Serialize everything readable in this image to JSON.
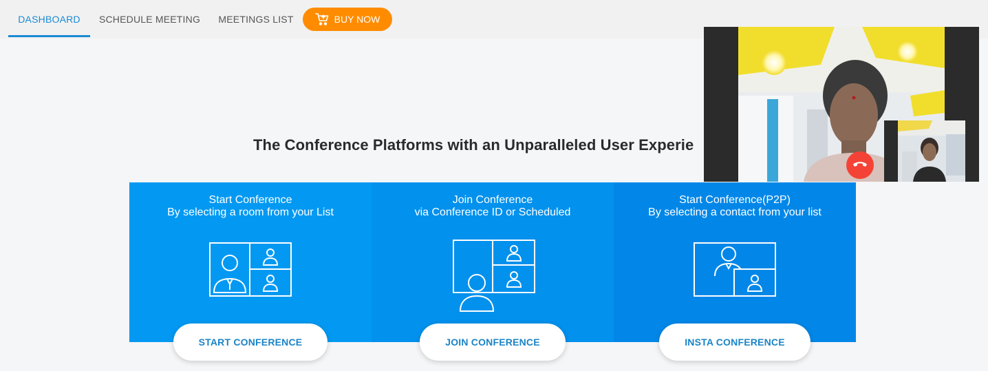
{
  "nav": {
    "tabs": [
      {
        "label": "DASHBOARD",
        "active": true
      },
      {
        "label": "SCHEDULE MEETING",
        "active": false
      },
      {
        "label": "MEETINGS LIST",
        "active": false
      }
    ],
    "buy_now": "BUY NOW",
    "buy_icon": "cart-plus-icon"
  },
  "headline": "The Conference Platforms with an Unparalleled User Experie",
  "cards": [
    {
      "title": "Start Conference",
      "subtitle": "By selecting a room from your List",
      "button": "START CONFERENCE",
      "icon": "group-video-icon"
    },
    {
      "title": "Join Conference",
      "subtitle": "via Conference ID or Scheduled",
      "button": "JOIN CONFERENCE",
      "icon": "join-video-icon"
    },
    {
      "title": "Start Conference(P2P)",
      "subtitle": "By selecting a contact from your list",
      "button": "INSTA CONFERENCE",
      "icon": "p2p-video-icon"
    }
  ],
  "video": {
    "hangup_icon": "phone-hangup-icon"
  },
  "colors": {
    "accent": "#1a8ad4",
    "buy_now": "#ff8c00",
    "card_1": "#0399f2",
    "card_2": "#0291ed",
    "card_3": "#0287e8",
    "hangup": "#f44336"
  }
}
